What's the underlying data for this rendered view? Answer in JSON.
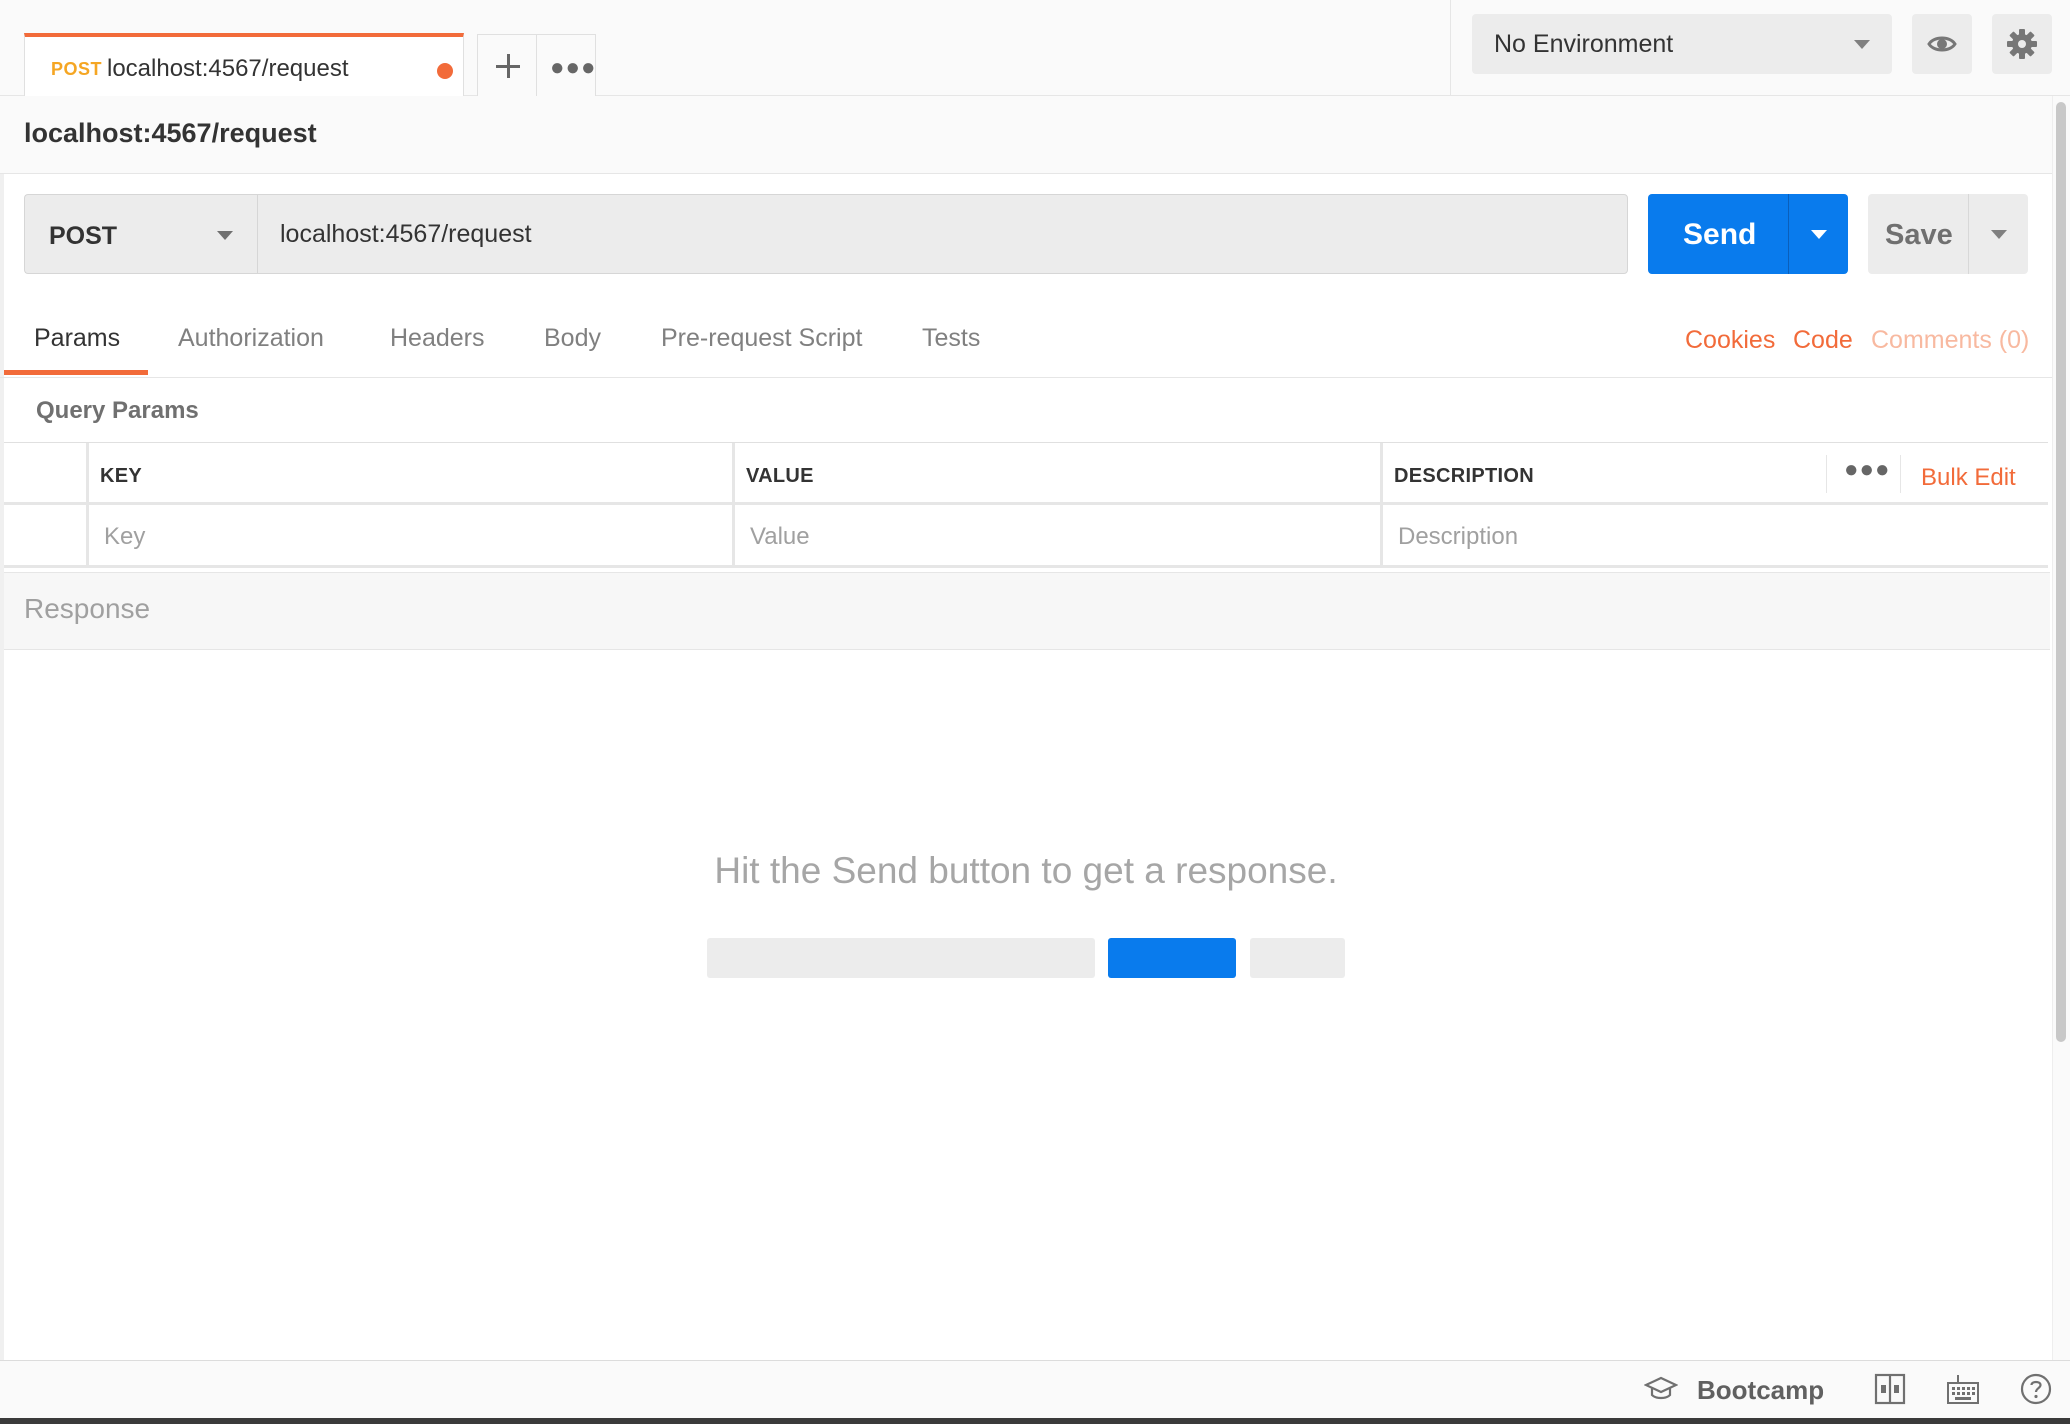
{
  "tabs": [
    {
      "method": "POST",
      "title": "localhost:4567/request",
      "unsaved": true
    }
  ],
  "environment": {
    "selected": "No Environment"
  },
  "request": {
    "title": "localhost:4567/request",
    "method": "POST",
    "url": "localhost:4567/request",
    "send_label": "Send",
    "save_label": "Save"
  },
  "request_tabs": {
    "items": [
      "Params",
      "Authorization",
      "Headers",
      "Body",
      "Pre-request Script",
      "Tests"
    ],
    "active": "Params",
    "links": {
      "cookies": "Cookies",
      "code": "Code",
      "comments": "Comments (0)"
    }
  },
  "query_params": {
    "label": "Query Params",
    "columns": [
      "KEY",
      "VALUE",
      "DESCRIPTION"
    ],
    "bulk_edit": "Bulk Edit",
    "placeholders": {
      "key": "Key",
      "value": "Value",
      "description": "Description"
    }
  },
  "response": {
    "label": "Response",
    "empty_message": "Hit the Send button to get a response."
  },
  "status_bar": {
    "bootcamp": "Bootcamp"
  },
  "colors": {
    "accent": "#f26b3a",
    "primary": "#097bed",
    "post_method": "#f5a623"
  },
  "icons": [
    "plus-icon",
    "more-icon",
    "eye-icon",
    "gear-icon",
    "caret-down-icon",
    "graduation-cap-icon",
    "two-pane-icon",
    "keyboard-icon",
    "help-icon"
  ]
}
